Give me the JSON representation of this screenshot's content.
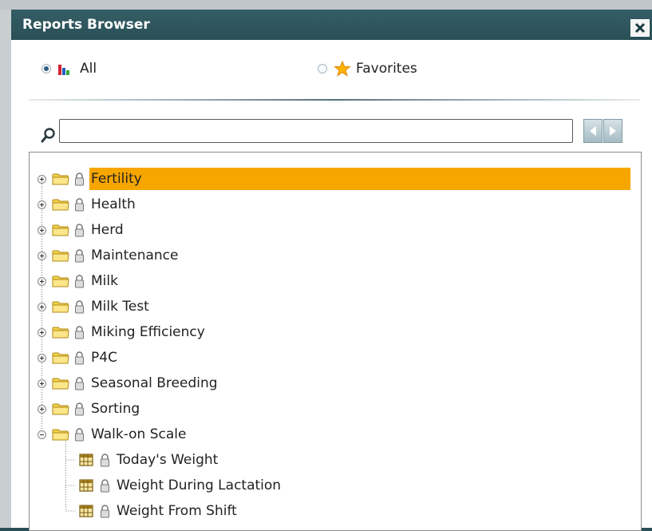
{
  "window": {
    "title": "Reports Browser",
    "close_icon": "close-x-icon"
  },
  "filter": {
    "all_label": "All",
    "favorites_label": "Favorites",
    "selected": "All",
    "all_icon": "bar-chart-icon",
    "favorites_icon": "star-icon"
  },
  "search": {
    "value": "",
    "placeholder": "",
    "icon": "magnifier-icon",
    "prev_icon": "arrow-left-icon",
    "next_icon": "arrow-right-icon"
  },
  "tree": {
    "folders": [
      {
        "label": "Fertility",
        "expanded": false,
        "selected": true
      },
      {
        "label": "Health",
        "expanded": false,
        "selected": false
      },
      {
        "label": "Herd",
        "expanded": false,
        "selected": false
      },
      {
        "label": "Maintenance",
        "expanded": false,
        "selected": false
      },
      {
        "label": "Milk",
        "expanded": false,
        "selected": false
      },
      {
        "label": "Milk Test",
        "expanded": false,
        "selected": false
      },
      {
        "label": "Miking Efficiency",
        "expanded": false,
        "selected": false
      },
      {
        "label": "P4C",
        "expanded": false,
        "selected": false
      },
      {
        "label": "Seasonal Breeding",
        "expanded": false,
        "selected": false
      },
      {
        "label": "Sorting",
        "expanded": false,
        "selected": false
      },
      {
        "label": "Walk-on Scale",
        "expanded": true,
        "selected": false
      }
    ],
    "reports": [
      {
        "label": "Today's Weight"
      },
      {
        "label": "Weight During Lactation"
      },
      {
        "label": "Weight From Shift"
      }
    ]
  },
  "colors": {
    "titlebar": "#2a4f57",
    "selection": "#f7a600",
    "folder": "#f3d24a",
    "report_icon": "#7a5c12"
  }
}
